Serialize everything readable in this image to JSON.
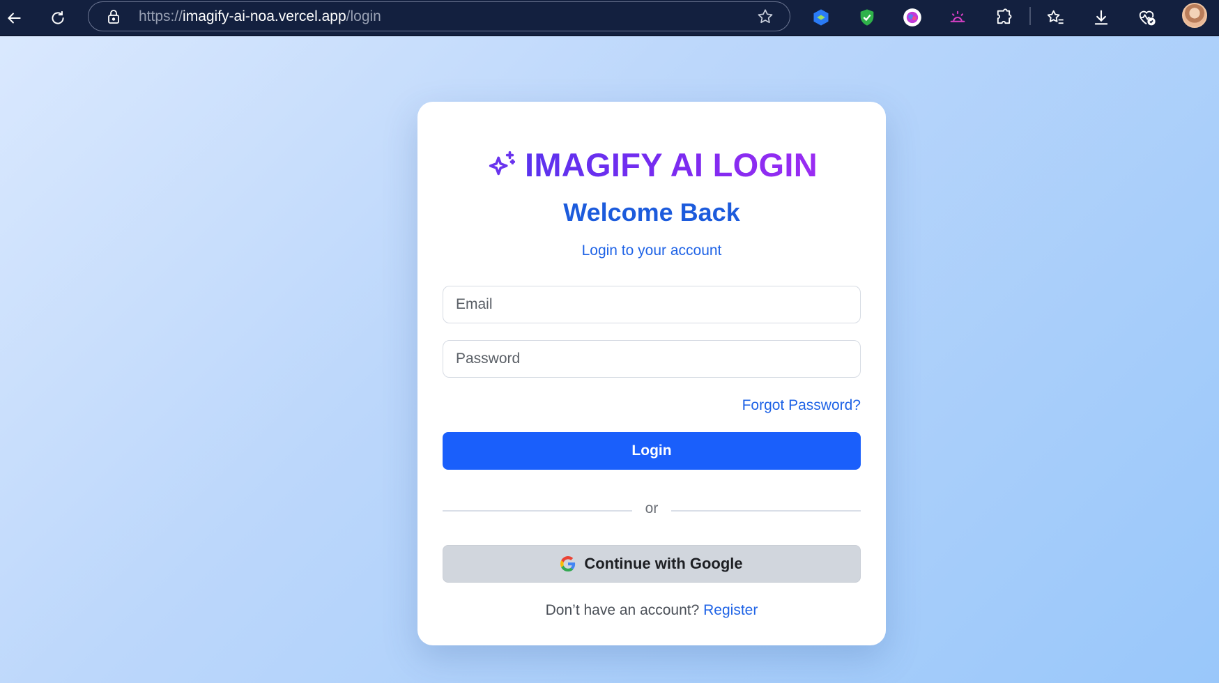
{
  "browser": {
    "url_scheme": "https://",
    "url_host": "imagify-ai-noa.vercel.app",
    "url_path": "/login",
    "icons": [
      "back-icon",
      "reload-icon",
      "lock-icon",
      "bookmark-star-icon",
      "extension-blue-icon",
      "extension-shield-icon",
      "extension-brain-icon",
      "extension-cloud-icon",
      "extensions-puzzle-icon",
      "favorites-icon",
      "downloads-icon",
      "browser-health-icon",
      "profile-avatar"
    ]
  },
  "login_card": {
    "brand_title": "IMAGIFY AI LOGIN",
    "heading": "Welcome Back",
    "subtitle": "Login to your account",
    "email_placeholder": "Email",
    "password_placeholder": "Password",
    "forgot_password": "Forgot Password?",
    "login_button": "Login",
    "divider_text": "or",
    "google_button": "Continue with Google",
    "register_prompt": "Don’t have an account?",
    "register_link": "Register"
  },
  "colors": {
    "primary_blue": "#1a5ffb",
    "brand_purple": "#7a2bf0",
    "heading_blue": "#1c5bdc",
    "link_blue": "#1f63e6",
    "topbar": "#13203f"
  }
}
